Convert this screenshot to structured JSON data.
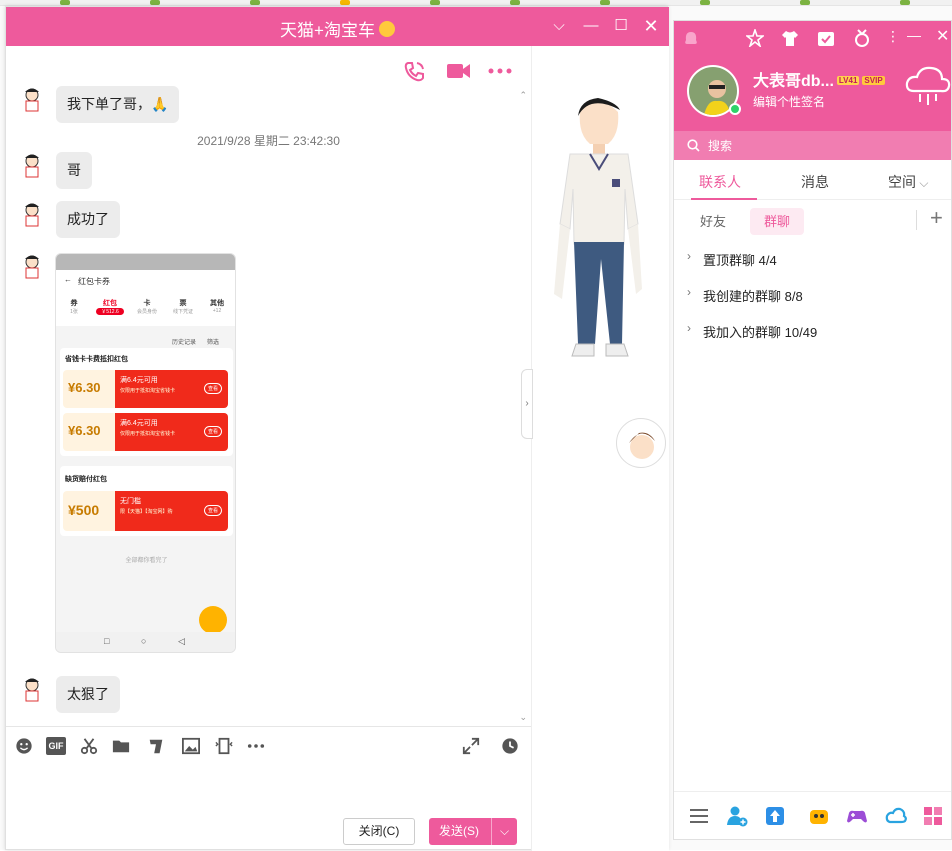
{
  "chat_window": {
    "title": "天猫+淘宝车",
    "messages": [
      {
        "type": "text",
        "text": "我下单了哥，🙏"
      },
      {
        "type": "timestamp",
        "text": "2021/9/28 星期二 23:42:30"
      },
      {
        "type": "text",
        "text": "哥"
      },
      {
        "type": "text",
        "text": "成功了"
      },
      {
        "type": "image"
      },
      {
        "type": "text",
        "text": "太狠了"
      }
    ],
    "shared_screenshot": {
      "page_title": "红包卡券",
      "tabs": [
        {
          "label": "券",
          "sub": "1张"
        },
        {
          "label": "红包",
          "sub": "￥512.6"
        },
        {
          "label": "卡",
          "sub": "会员身份"
        },
        {
          "label": "票",
          "sub": "线下凭证"
        },
        {
          "label": "其他",
          "sub": "+12"
        }
      ],
      "history_label": "历史记录",
      "filter_label": "筛选",
      "section1_title": "省钱卡卡费抵扣红包",
      "section2_title": "缺货赔付红包",
      "coupons": [
        {
          "amount": "6.30",
          "title": "满6.4元可用",
          "desc": "仅限用于抵扣淘宝省钱卡",
          "action": "查看"
        },
        {
          "amount": "6.30",
          "title": "满6.4元可用",
          "desc": "仅限用于抵扣淘宝省钱卡",
          "action": "查看"
        },
        {
          "amount": "500",
          "title": "无门槛",
          "desc": "限【天猫】【淘宝网】购",
          "action": "查看"
        }
      ],
      "footer": "全部都你看完了"
    },
    "close_button": "关闭(C)",
    "send_button": "发送(S)"
  },
  "qq_panel": {
    "username": "大表哥db...",
    "level_badge": "LV41",
    "vip_badge": "SVIP",
    "signature": "编辑个性签名",
    "search_placeholder": "搜索",
    "tabs": [
      "联系人",
      "消息",
      "空间"
    ],
    "sub_tabs": [
      "好友",
      "群聊"
    ],
    "groups": [
      {
        "name": "置顶群聊",
        "count": "4/4"
      },
      {
        "name": "我创建的群聊",
        "count": "8/8"
      },
      {
        "name": "我加入的群聊",
        "count": "10/49"
      }
    ]
  },
  "colors": {
    "accent": "#ee5a9c"
  }
}
